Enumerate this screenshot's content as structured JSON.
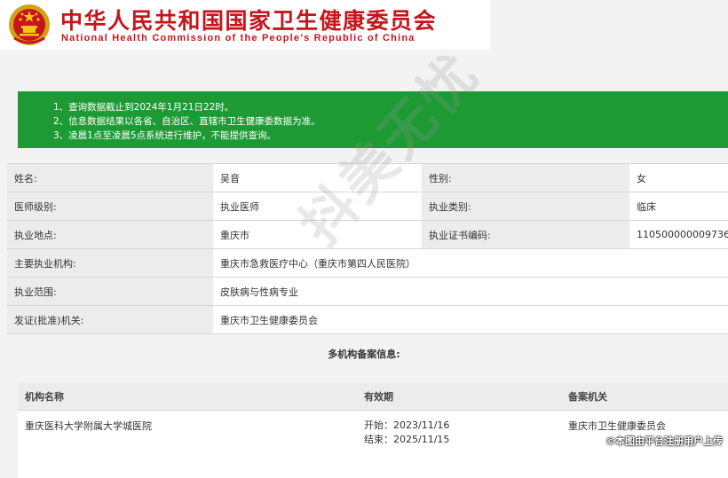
{
  "header": {
    "title_cn": "中华人民共和国国家卫生健康委员会",
    "title_en": "National Health Commission of the People’s Republic of China"
  },
  "notice": {
    "lines": [
      "1、查询数据截止到2024年1月21日22时。",
      "2、信息数据结果以各省、自治区、直辖市卫生健康委数据为准。",
      "3、凌晨1点至凌晨5点系统进行维护，不能提供查询。"
    ]
  },
  "info": {
    "name_label": "姓名:",
    "name_value": "吴音",
    "gender_label": "性别:",
    "gender_value": "女",
    "level_label": "医师级别:",
    "level_value": "执业医师",
    "category_label": "执业类别:",
    "category_value": "临床",
    "location_label": "执业地点:",
    "location_value": "重庆市",
    "cert_label": "执业证书编码:",
    "cert_value": "110500000009736",
    "institution_label": "主要执业机构:",
    "institution_value": "重庆市急救医疗中心（重庆市第四人民医院）",
    "scope_label": "执业范围:",
    "scope_value": "皮肤病与性病专业",
    "issuer_label": "发证(批准)机关:",
    "issuer_value": "重庆市卫生健康委员会"
  },
  "multi": {
    "title": "多机构备案信息:",
    "headers": [
      "机构名称",
      "有效期",
      "备案机关"
    ],
    "rows": [
      {
        "institution": "重庆医科大学附属大学城医院",
        "start": "开始：2023/11/16",
        "end": "结束：2025/11/15",
        "authority": "重庆市卫生健康委员会"
      }
    ]
  },
  "watermark": "抖美无忧",
  "footer_watermark": "©本图由平台注册用户上传",
  "colors": {
    "brand_red": "#c4161c",
    "notice_green": "#1e9a35"
  }
}
